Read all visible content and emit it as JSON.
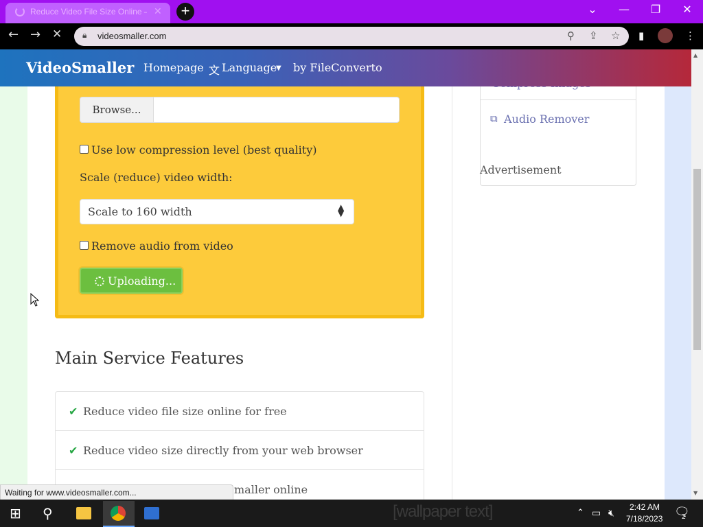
{
  "browser": {
    "tab_title": "Reduce Video File Size Online — F",
    "url": "videosmaller.com",
    "status_text": "Waiting for www.videosmaller.com..."
  },
  "site": {
    "brand": "VideoSmaller",
    "nav": {
      "homepage": "Homepage",
      "language": "Language",
      "by": "by FileConverto"
    }
  },
  "form": {
    "browse_label": "Browse...",
    "low_compression_label": "Use low compression level (best quality)",
    "scale_label": "Scale (reduce) video width:",
    "scale_value": "Scale to 160 width",
    "remove_audio_label": "Remove audio from video",
    "upload_label": "Uploading..."
  },
  "sidebar": {
    "partial_link": "Compress Images",
    "audio_remover": "Audio Remover",
    "ad_label": "Advertisement"
  },
  "features": {
    "title": "Main Service Features",
    "items": [
      "Reduce video file size online for free",
      "Reduce video size directly from your web browser",
      "maller online"
    ]
  },
  "taskbar": {
    "time": "2:42 AM",
    "date": "7/18/2023",
    "notification_count": "2",
    "wallpaper_text": "[wallpaper text]"
  },
  "colors": {
    "titlebar": "#a010f0",
    "upload_box": "#fdcb3b",
    "upload_button": "#6cbf3f",
    "check": "#28a745"
  }
}
